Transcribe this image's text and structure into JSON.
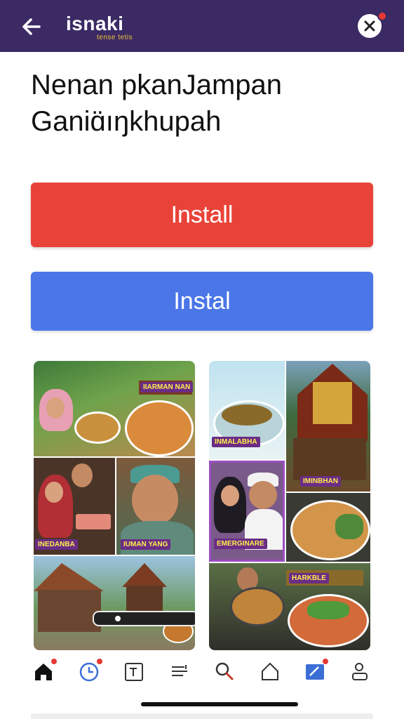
{
  "header": {
    "app_name": "isnaki",
    "app_subtitle": "tense tetis"
  },
  "title": {
    "line1": "Nenan pkanJampan",
    "line2": "Ganiɑ̈ıŋkhupah"
  },
  "buttons": {
    "primary_label": "Install",
    "secondary_label": "Instal"
  },
  "gallery": {
    "labels": [
      "IIARMAN NAN",
      "INEDANBA",
      "IUMAN YANG",
      "INMALABHA",
      "IMINBHAN",
      "EMERGINARE",
      "HARKBLE"
    ]
  },
  "nav": {
    "items": [
      "home-icon",
      "clock-icon",
      "calendar-icon",
      "list-icon",
      "search-icon",
      "house-icon",
      "edit-icon",
      "profile-icon"
    ]
  },
  "colors": {
    "header_bg": "#3b2a63",
    "install_red": "#e94339",
    "install_blue": "#4a76e8",
    "nav_active": "#3b6fd6"
  }
}
